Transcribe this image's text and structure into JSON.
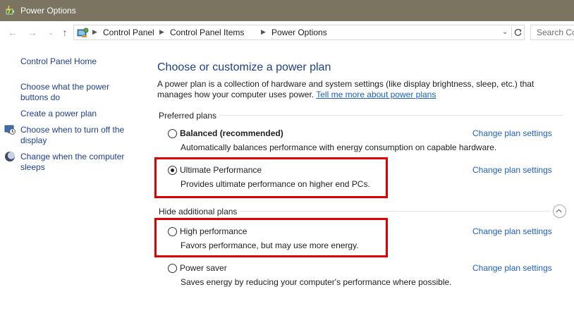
{
  "window": {
    "title": "Power Options"
  },
  "address": {
    "crumbs": [
      "Control Panel",
      "Control Panel Items",
      "Power Options"
    ],
    "search_placeholder": "Search Co"
  },
  "sidebar": {
    "home": "Control Panel Home",
    "links": [
      "Choose what the power buttons do",
      "Create a power plan",
      "Choose when to turn off the display",
      "Change when the computer sleeps"
    ]
  },
  "main": {
    "heading": "Choose or customize a power plan",
    "description": "A power plan is a collection of hardware and system settings (like display brightness, sleep, etc.) that manages how your computer uses power.",
    "description_link": "Tell me more about power plans",
    "preferred_label": "Preferred plans",
    "additional_label": "Hide additional plans",
    "change_label": "Change plan settings",
    "plans": [
      {
        "name": "Balanced (recommended)",
        "desc": "Automatically balances performance with energy consumption on capable hardware.",
        "selected": false
      },
      {
        "name": "Ultimate Performance",
        "desc": "Provides ultimate performance on higher end PCs.",
        "selected": true
      },
      {
        "name": "High performance",
        "desc": "Favors performance, but may use more energy.",
        "selected": false
      },
      {
        "name": "Power saver",
        "desc": "Saves energy by reducing your computer's performance where possible.",
        "selected": false
      }
    ]
  },
  "colors": {
    "titlebar": "#7a7461",
    "link": "#1f5fbf",
    "heading": "#1e3f8c",
    "highlight": "#e00000"
  }
}
